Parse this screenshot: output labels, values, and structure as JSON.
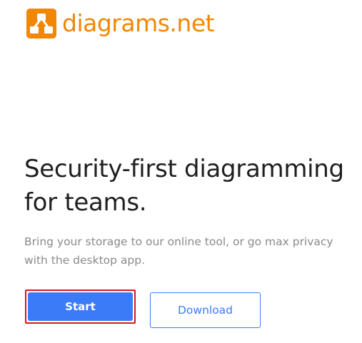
{
  "brand": {
    "name": "diagrams.net",
    "color": "#f08705"
  },
  "hero": {
    "headline": "Security-first diagramming for teams.",
    "subtext": "Bring your storage to our online tool, or go max privacy with the desktop app."
  },
  "actions": {
    "start_label": "Start",
    "download_label": "Download",
    "primary_color": "#3b7bf7",
    "focus_outline_color": "#d31a1a"
  },
  "icons": {
    "logo": "diagram-logo-icon"
  }
}
